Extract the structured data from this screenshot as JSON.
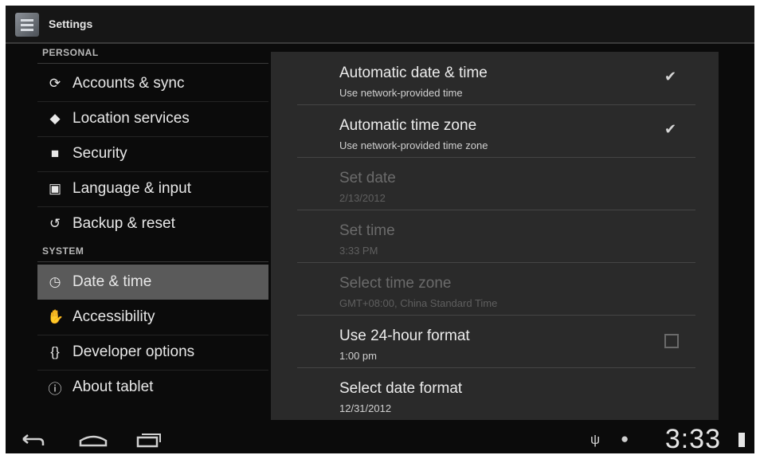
{
  "app": {
    "title": "Settings",
    "icon": "settings-icon"
  },
  "sidebar": {
    "personal_header": "PERSONAL",
    "system_header": "SYSTEM",
    "personal_items": [
      {
        "label": "Accounts & sync",
        "icon": "sync-icon"
      },
      {
        "label": "Location services",
        "icon": "location-icon"
      },
      {
        "label": "Security",
        "icon": "lock-icon"
      },
      {
        "label": "Language & input",
        "icon": "keyboard-icon"
      },
      {
        "label": "Backup & reset",
        "icon": "backup-icon"
      }
    ],
    "system_items": [
      {
        "label": "Date & time",
        "icon": "clock-icon",
        "selected": true
      },
      {
        "label": "Accessibility",
        "icon": "accessibility-icon"
      },
      {
        "label": "Developer options",
        "icon": "braces-icon"
      },
      {
        "label": "About tablet",
        "icon": "info-icon"
      }
    ]
  },
  "date_time": {
    "items": [
      {
        "title": "Automatic date & time",
        "summary": "Use network-provided time",
        "control": "checkbox",
        "checked": true,
        "enabled": true
      },
      {
        "title": "Automatic time zone",
        "summary": "Use network-provided time zone",
        "control": "checkbox",
        "checked": true,
        "enabled": true
      },
      {
        "title": "Set date",
        "summary": "2/13/2012",
        "enabled": false
      },
      {
        "title": "Set time",
        "summary": "3:33 PM",
        "enabled": false
      },
      {
        "title": "Select time zone",
        "summary": "GMT+08:00, China Standard Time",
        "enabled": false
      },
      {
        "title": "Use 24-hour format",
        "summary": "1:00 pm",
        "control": "checkbox",
        "checked": false,
        "enabled": true
      },
      {
        "title": "Select date format",
        "summary": "12/31/2012",
        "enabled": true
      }
    ]
  },
  "system_bar": {
    "clock": "3:33",
    "icons": [
      "back-icon",
      "home-icon",
      "recent-apps-icon",
      "usb-icon",
      "android-icon",
      "battery-icon"
    ]
  },
  "colors": {
    "selected_bg": "#5a5a5a",
    "panel_bg": "#2a2a2a",
    "screen_bg": "#0b0b0b"
  }
}
